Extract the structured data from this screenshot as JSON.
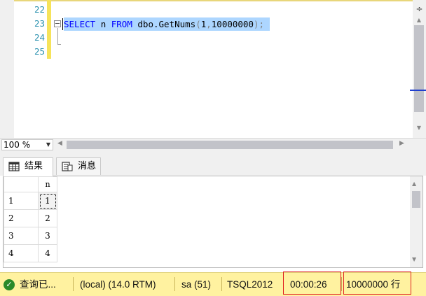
{
  "editor": {
    "line_numbers": [
      "22",
      "23",
      "24",
      "25"
    ],
    "code": {
      "kw_select": "SELECT",
      "col": "n",
      "kw_from": "FROM",
      "func": "dbo.GetNums",
      "paren_open": "(",
      "arg1": "1",
      "comma": ",",
      "arg2": "10000000",
      "paren_close": ")",
      "semicolon": ";"
    }
  },
  "zoom": {
    "value": "100 %"
  },
  "tabs": {
    "results_label": "结果",
    "messages_label": "消息"
  },
  "grid": {
    "column_header": "n",
    "rows": [
      {
        "rownum": "1",
        "n": "1"
      },
      {
        "rownum": "2",
        "n": "2"
      },
      {
        "rownum": "3",
        "n": "3"
      },
      {
        "rownum": "4",
        "n": "4"
      }
    ]
  },
  "status": {
    "query_state": "查询已...",
    "server": "(local) (14.0 RTM)",
    "user": "sa (51)",
    "database": "TSQL2012",
    "elapsed": "00:00:26",
    "rows": "10000000 行"
  },
  "colors": {
    "status_bar_bg": "#fff2a0",
    "selection": "#add6ff",
    "line_number": "#2b91af",
    "keyword": "#0000ff",
    "highlight_box": "#e02020"
  }
}
